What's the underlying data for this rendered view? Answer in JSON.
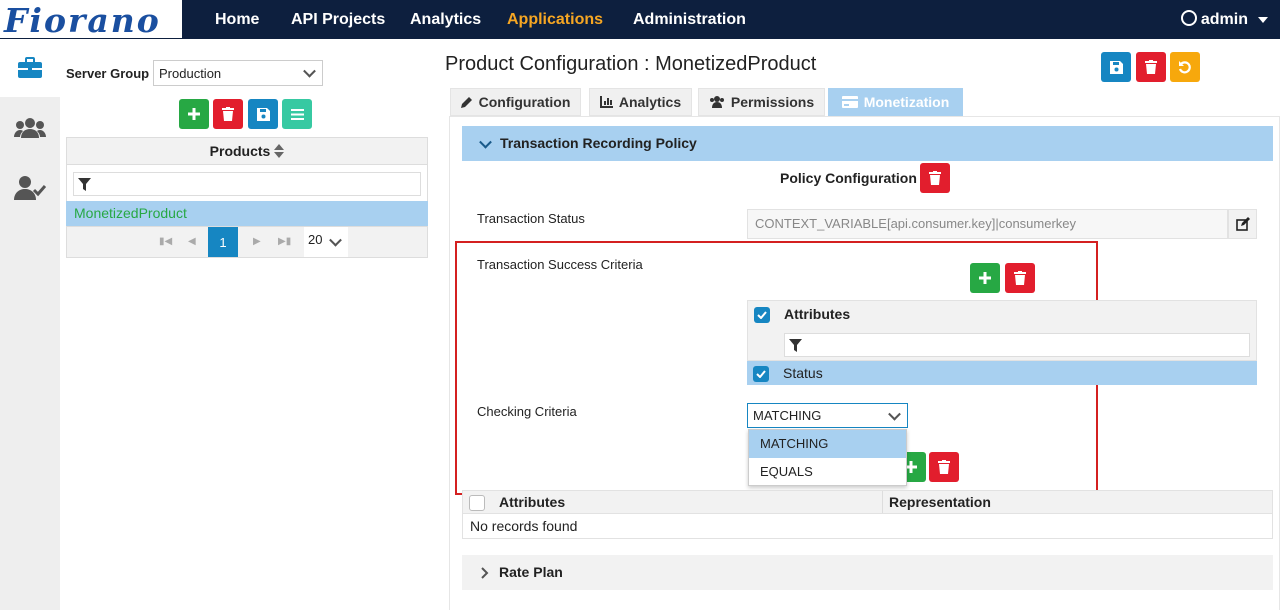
{
  "brand": {
    "logo_text": "Fiorano"
  },
  "nav": {
    "items": [
      "Home",
      "API Projects",
      "Analytics",
      "Applications",
      "Administration"
    ],
    "active": "Applications",
    "user": "admin"
  },
  "left_panel": {
    "server_group_label": "Server Group",
    "server_group_value": "Production",
    "products_header": "Products",
    "products": [
      "MonetizedProduct"
    ],
    "pagination": {
      "current_page": "1",
      "page_size": "20"
    }
  },
  "main": {
    "title": "Product Configuration : MonetizedProduct",
    "tabs": [
      "Configuration",
      "Analytics",
      "Permissions",
      "Monetization"
    ],
    "active_tab": "Monetization",
    "section_title": "Transaction Recording Policy",
    "policy_configuration_label": "Policy Configuration",
    "transaction_status_label": "Transaction Status",
    "transaction_status_value": "CONTEXT_VARIABLE[api.consumer.key]|consumerkey",
    "success_criteria_label": "Transaction Success Criteria",
    "attributes_header": "Attributes",
    "attribute_rows": [
      "Status"
    ],
    "checking_criteria_label": "Checking Criteria",
    "checking_criteria_value": "MATCHING",
    "checking_criteria_options": [
      "MATCHING",
      "EQUALS"
    ],
    "bottom_table": {
      "columns": [
        "Attributes",
        "Representation"
      ],
      "empty_message": "No records found"
    },
    "rate_plan_title": "Rate Plan"
  },
  "colors": {
    "nav_bg": "#0d1f3e",
    "accent": "#f6a623",
    "highlight_box": "#d42020",
    "selected_row": "#a8d0f0"
  }
}
